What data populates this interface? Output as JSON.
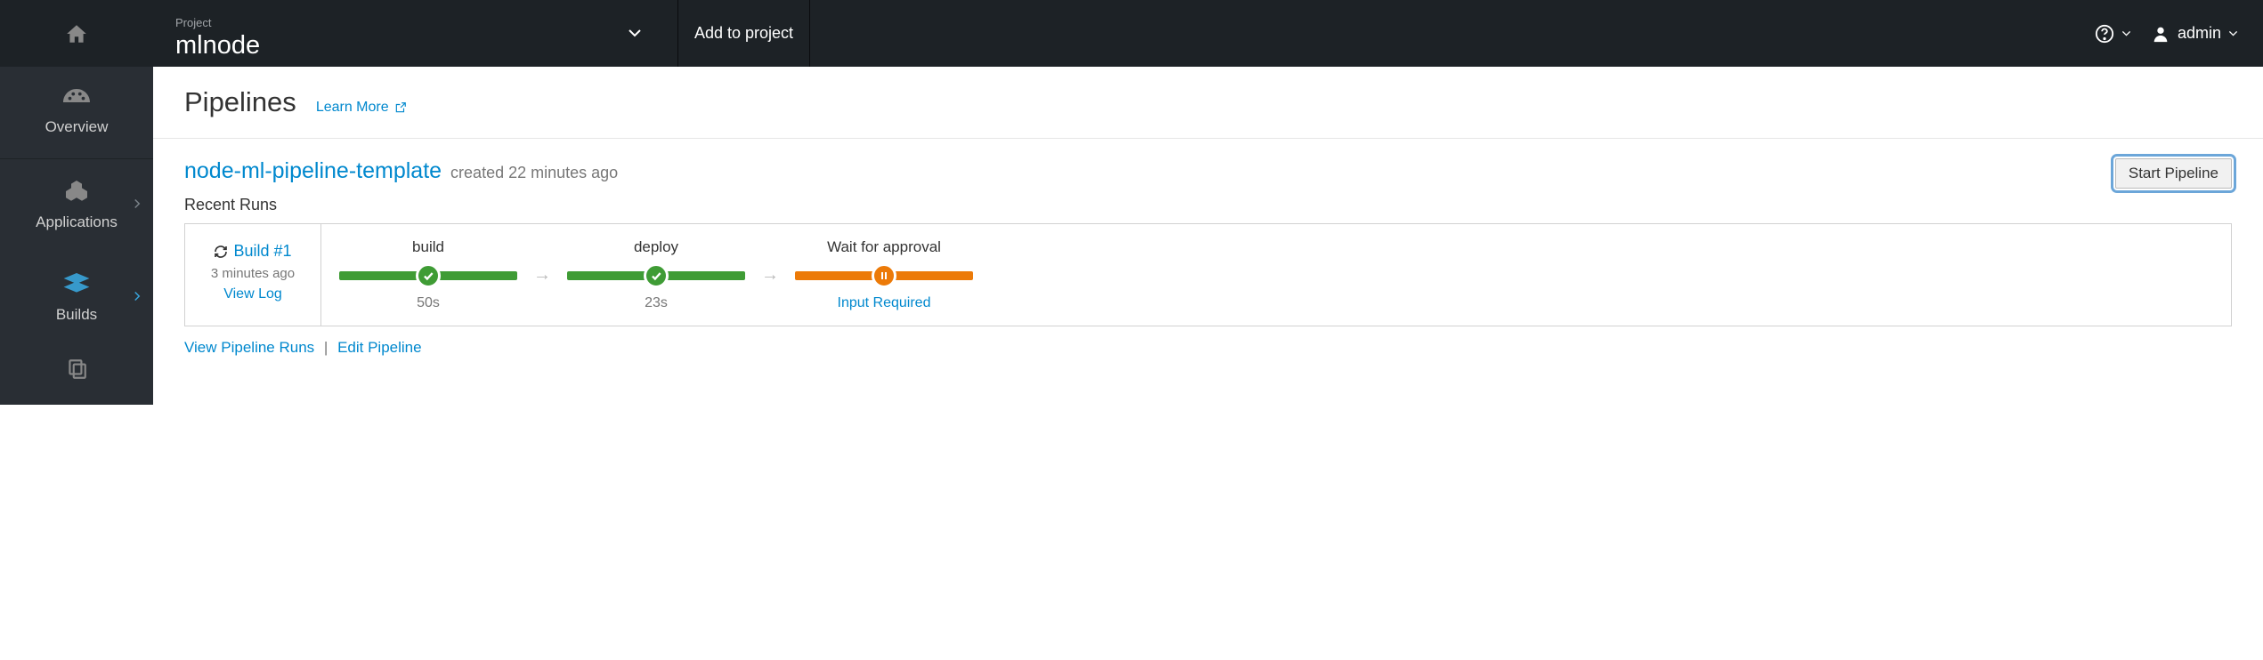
{
  "topbar": {
    "project_label": "Project",
    "project_name": "mlnode",
    "add_to_project": "Add to project",
    "user": "admin"
  },
  "sidebar": {
    "items": [
      {
        "label": "Overview"
      },
      {
        "label": "Applications"
      },
      {
        "label": "Builds"
      }
    ]
  },
  "page": {
    "title": "Pipelines",
    "learn_more": "Learn More"
  },
  "pipeline": {
    "name": "node-ml-pipeline-template",
    "created": "created 22 minutes ago",
    "start_button": "Start Pipeline",
    "recent_runs_label": "Recent Runs",
    "run": {
      "build_label": "Build #1",
      "age": "3 minutes ago",
      "view_log": "View Log"
    },
    "stages": [
      {
        "name": "build",
        "sub": "50s",
        "status": "success"
      },
      {
        "name": "deploy",
        "sub": "23s",
        "status": "success"
      },
      {
        "name": "Wait for approval",
        "sub": "Input Required",
        "status": "pending"
      }
    ],
    "footer": {
      "view_runs": "View Pipeline Runs",
      "edit": "Edit Pipeline"
    }
  }
}
